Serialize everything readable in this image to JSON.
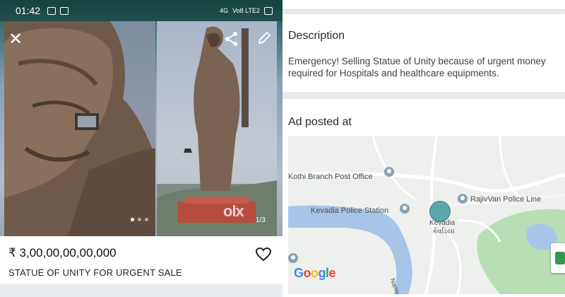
{
  "status_bar": {
    "time": "01:42",
    "network_label": "4G",
    "lte_label": "Vo8 LTE2"
  },
  "listing": {
    "price": "₹ 3,00,00,00,00,000",
    "title": "STATUE OF UNITY FOR URGENT SALE",
    "photo_counter": "1/3",
    "watermark": "olx",
    "current_photo": 1,
    "total_photos": 3
  },
  "description": {
    "heading": "Description",
    "text": "Emergency! Selling Statue of Unity because of urgent money required for Hospitals and healthcare equipments."
  },
  "ad_location": {
    "heading": "Ad posted at",
    "map_labels": {
      "post_office": "Kothi Branch Post Office",
      "police_line": "RajivVan Police Line",
      "police_station": "Kevadia Police Station",
      "town": "Kevadia",
      "town_native": "કેવડિયા",
      "river": "Narmada R"
    },
    "google_letters": [
      "G",
      "o",
      "o",
      "g",
      "l",
      "e"
    ]
  },
  "colors": {
    "google_blue": "#4285F4",
    "google_red": "#EA4335",
    "google_yellow": "#FBBC05",
    "google_green": "#34A853",
    "water": "#a7c5e8",
    "park": "#b7dfb3",
    "marker": "#5aa6ad"
  },
  "icons": {
    "close": "close-icon",
    "share": "share-icon",
    "edit": "pencil-icon",
    "favorite": "heart-icon"
  }
}
